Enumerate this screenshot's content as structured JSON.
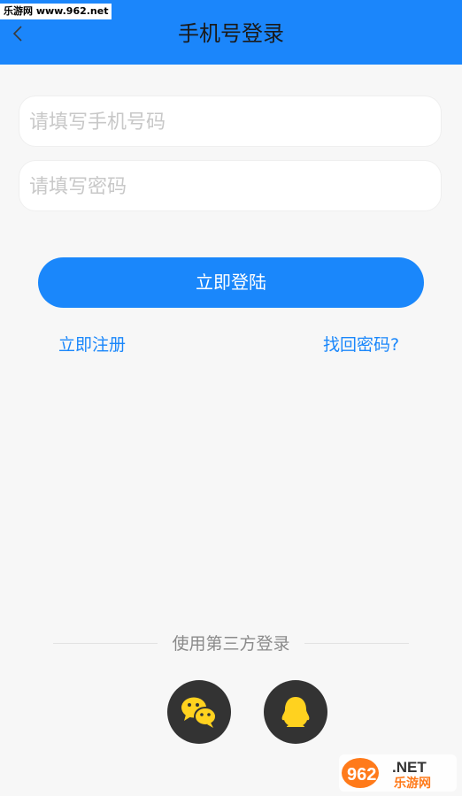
{
  "watermark_top": "乐游网 www.962.net",
  "header": {
    "title": "手机号登录",
    "back_icon": "chevron-left-icon"
  },
  "form": {
    "phone_placeholder": "请填写手机号码",
    "password_placeholder": "请填写密码",
    "login_label": "立即登陆"
  },
  "links": {
    "register": "立即注册",
    "forgot": "找回密码?"
  },
  "third_party": {
    "label": "使用第三方登录",
    "buttons": [
      "wechat-icon",
      "qq-icon"
    ]
  },
  "watermark_bottom": {
    "brand": "962",
    "suffix": ".NET",
    "sub": "乐游网"
  },
  "colors": {
    "accent": "#1a87fb",
    "header": "#1b86fb",
    "background": "#f7f7f7",
    "social_bg": "#333333",
    "social_icon": "#ffd21f"
  }
}
